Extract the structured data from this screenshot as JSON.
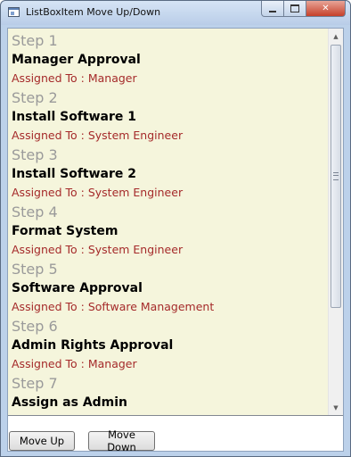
{
  "window": {
    "title": "ListBoxItem Move Up/Down",
    "icon": "app-window-icon",
    "caption_buttons": [
      "minimize-icon",
      "maximize-icon",
      "close-icon"
    ],
    "close_glyph": "✕"
  },
  "list": {
    "background": "#f5f5dc",
    "items": [
      {
        "step": "Step 1",
        "name": "Manager Approval",
        "assigned": "Assigned To : Manager"
      },
      {
        "step": "Step 2",
        "name": "Install Software 1",
        "assigned": "Assigned To : System Engineer"
      },
      {
        "step": "Step 3",
        "name": "Install Software 2",
        "assigned": "Assigned To : System Engineer"
      },
      {
        "step": "Step 4",
        "name": "Format System",
        "assigned": "Assigned To : System Engineer"
      },
      {
        "step": "Step 5",
        "name": "Software Approval",
        "assigned": "Assigned To : Software Management"
      },
      {
        "step": "Step 6",
        "name": "Admin Rights Approval",
        "assigned": "Assigned To : Manager"
      },
      {
        "step": "Step 7",
        "name": "Assign as Admin",
        "assigned": ""
      }
    ]
  },
  "scrollbar": {
    "up_glyph": "▲",
    "down_glyph": "▼"
  },
  "buttons": {
    "move_up": "Move Up",
    "move_down": "Move Down"
  }
}
